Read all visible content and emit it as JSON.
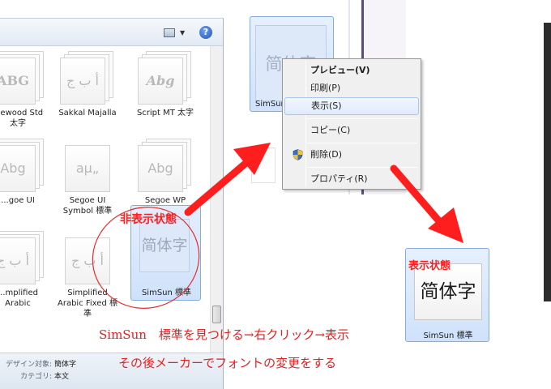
{
  "folder": {
    "help_icon": "help-icon",
    "view_icon": "view-options-icon",
    "fonts": [
      {
        "id": "birch",
        "glyph": "ABG",
        "name": "...ewood Std\n太字"
      },
      {
        "id": "sakkal",
        "glyph": "أ ب ج",
        "name": "Sakkal Majalla"
      },
      {
        "id": "script",
        "glyph": "Abg",
        "name": "Script MT 太字"
      },
      {
        "id": "segoe",
        "glyph": "Abg",
        "name": "...goe UI"
      },
      {
        "id": "segoe-symbol",
        "glyph": "aµ„",
        "name": "Segoe UI\nSymbol 標準"
      },
      {
        "id": "segoe-wp",
        "glyph": "Abg",
        "name": "Segoe WP"
      },
      {
        "id": "simp-arabic",
        "glyph": "أ ب ج",
        "name": "...mplified\nArabic"
      },
      {
        "id": "simp-arabic-fixed",
        "glyph": "أ ب ج",
        "name": "Simplified\nArabic Fixed 標\n準"
      }
    ],
    "selected": {
      "glyph": "简体字",
      "name": "SimSun 標準"
    },
    "details": {
      "design_label": "デザイン対象:",
      "design_value": "簡体字",
      "category_label": "カテゴリ:",
      "category_value": "本文"
    }
  },
  "context": {
    "tile_glyph": "简体字",
    "tile_name": "SimSun",
    "menu": [
      {
        "label": "プレビュー(V)",
        "bold": true
      },
      {
        "label": "印刷(P)"
      },
      {
        "label": "表示(S)",
        "hover": true
      },
      {
        "label": "コピー(C)"
      },
      {
        "label": "削除(D)",
        "icon": "shield-icon"
      },
      {
        "label": "プロパティ(R)"
      }
    ]
  },
  "result": {
    "glyph": "简体字",
    "name": "SimSun 標準"
  },
  "annotations": {
    "hidden_state": "非表示状態",
    "shown_state": "表示状態",
    "instruction_1": "SimSun　標準を見つける→右クリック→表示",
    "instruction_2": "その後メーカーでフォントの変更をする"
  },
  "colors": {
    "annotation_red": "#ff1e1e",
    "selection_blue": "#cfe2fb"
  }
}
